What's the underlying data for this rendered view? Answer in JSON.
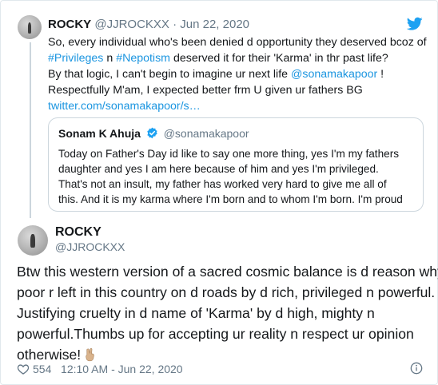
{
  "parent_tweet": {
    "name": "ROCKY",
    "handle": "@JJROCKXX",
    "separator": "·",
    "date": "Jun 22, 2020",
    "lines": [
      [
        "So, every individual who's been denied d opportunity they deserved bcoz of"
      ],
      [
        "#Privileges",
        " n ",
        "#Nepotism",
        " deserved it for their 'Karma' in thr past life?"
      ],
      [
        "By that logic, I can't begin to imagine ur next life ",
        "@sonamakapoor",
        " !"
      ],
      [
        "Respectfully M'am, I expected better frm U given ur fathers BG"
      ],
      [
        "twitter.com/sonamakapoor/s…"
      ]
    ]
  },
  "quoted_tweet": {
    "name": "Sonam K Ahuja",
    "handle": "@sonamakapoor",
    "lines": [
      "Today on Father's Day id like to say one more thing, yes I'm my fathers",
      "daughter and yes I am here because of him and yes I'm privileged.",
      "That's not an insult, my father has worked very hard to give me all of",
      "this. And it is my karma where I'm born and to whom I'm born. I'm proud"
    ]
  },
  "main_tweet": {
    "name": "ROCKY",
    "handle": "@JJROCKXX",
    "lines": [
      "Btw this western version of a sacred cosmic balance is d reason why d",
      "poor r left in this country on d roads by d rich, privileged n powerful.",
      "Justifying cruelty in d name of 'Karma' by d high, mighty n",
      "powerful.Thumbs up for accepting ur reality n respect ur opinion",
      "otherwise!"
    ],
    "likes": "554",
    "time": "12:10 AM - Jun 22, 2020"
  },
  "colors": {
    "link": "#1b95e0",
    "twitter_blue": "#1da1f2",
    "muted": "#657786",
    "border": "#e1e8ed"
  },
  "icons": [
    "twitter-bird-icon",
    "verified-badge-icon",
    "victory-hand-emoji-icon",
    "heart-icon",
    "info-icon"
  ]
}
